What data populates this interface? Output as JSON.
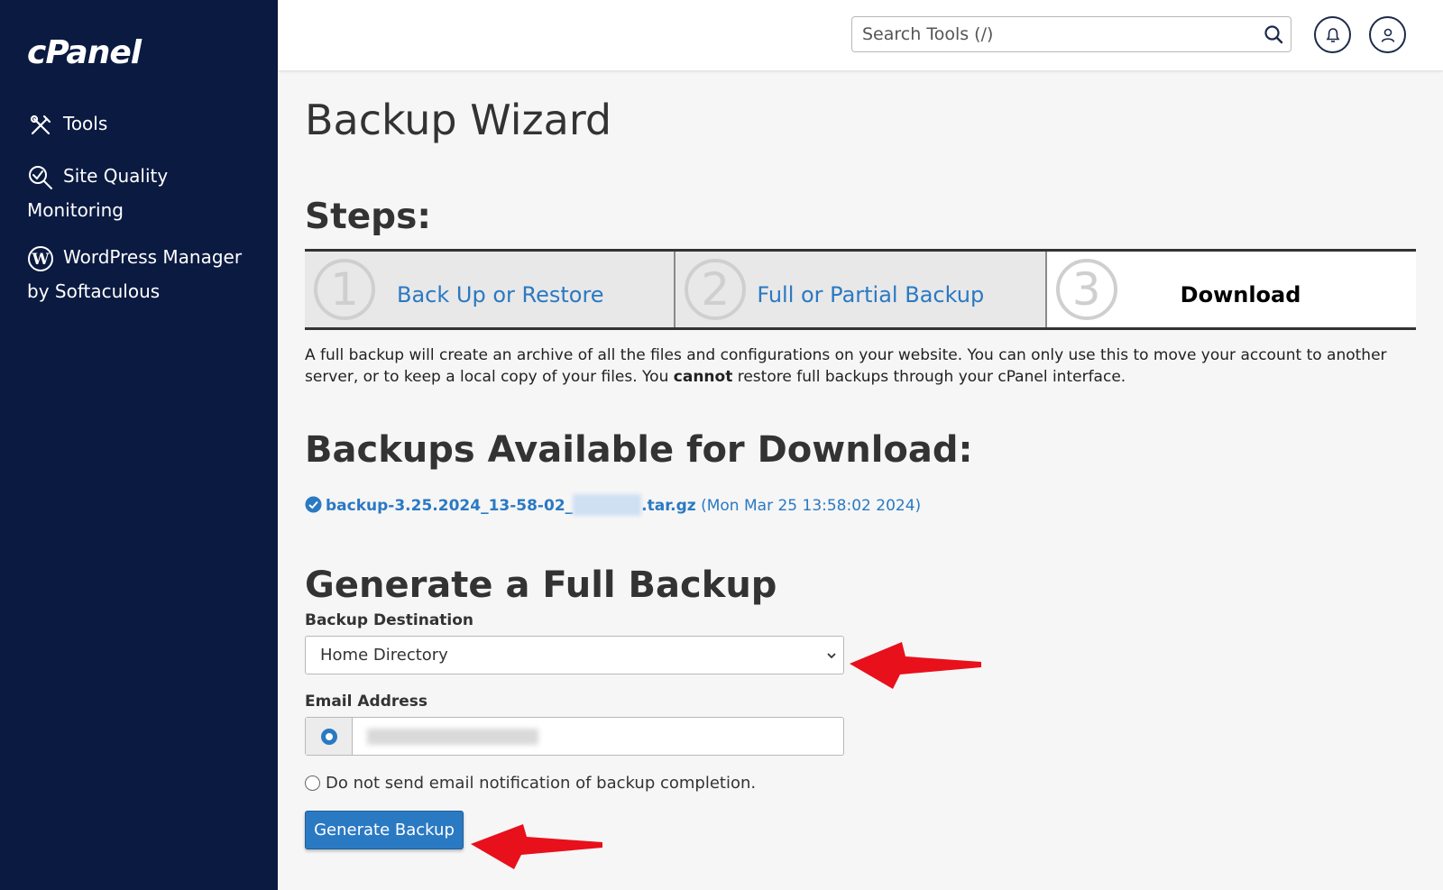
{
  "brand": {
    "logo_text": "cPanel"
  },
  "sidebar": {
    "items": [
      {
        "label": "Tools",
        "icon": "tools-icon"
      },
      {
        "label_line1": "Site Quality",
        "label_line2": "Monitoring",
        "icon": "site-quality-icon"
      },
      {
        "label_line1": "WordPress Manager",
        "label_line2": "by Softaculous",
        "icon": "wordpress-icon"
      }
    ]
  },
  "header": {
    "search_placeholder": "Search Tools (/)",
    "icons": [
      "search-icon",
      "bell-icon",
      "user-icon"
    ]
  },
  "page": {
    "title": "Backup Wizard",
    "steps_heading": "Steps:",
    "steps": [
      {
        "number": "1",
        "label": "Back Up or Restore"
      },
      {
        "number": "2",
        "label": "Full or Partial Backup"
      },
      {
        "number": "3",
        "label": "Download"
      }
    ],
    "description_part1": "A full backup will create an archive of all the files and configurations on your website. You can only use this to move your account to another server, or to keep a local copy of your files. You ",
    "description_bold": "cannot",
    "description_part2": " restore full backups through your cPanel interface.",
    "available_heading": "Backups Available for Download:",
    "backup_file_prefix": "backup-3.25.2024_13-58-02_",
    "backup_file_suffix": ".tar.gz",
    "backup_date": "(Mon Mar 25 13:58:02 2024)",
    "generate_heading": "Generate a Full Backup",
    "destination_label": "Backup Destination",
    "destination_value": "Home Directory",
    "email_label": "Email Address",
    "no_email_label": "Do not send email notification of backup completion.",
    "generate_button": "Generate Backup"
  },
  "colors": {
    "sidebar_bg": "#0b1a41",
    "accent": "#2a79c3",
    "annotation_arrow": "#e8101b"
  }
}
